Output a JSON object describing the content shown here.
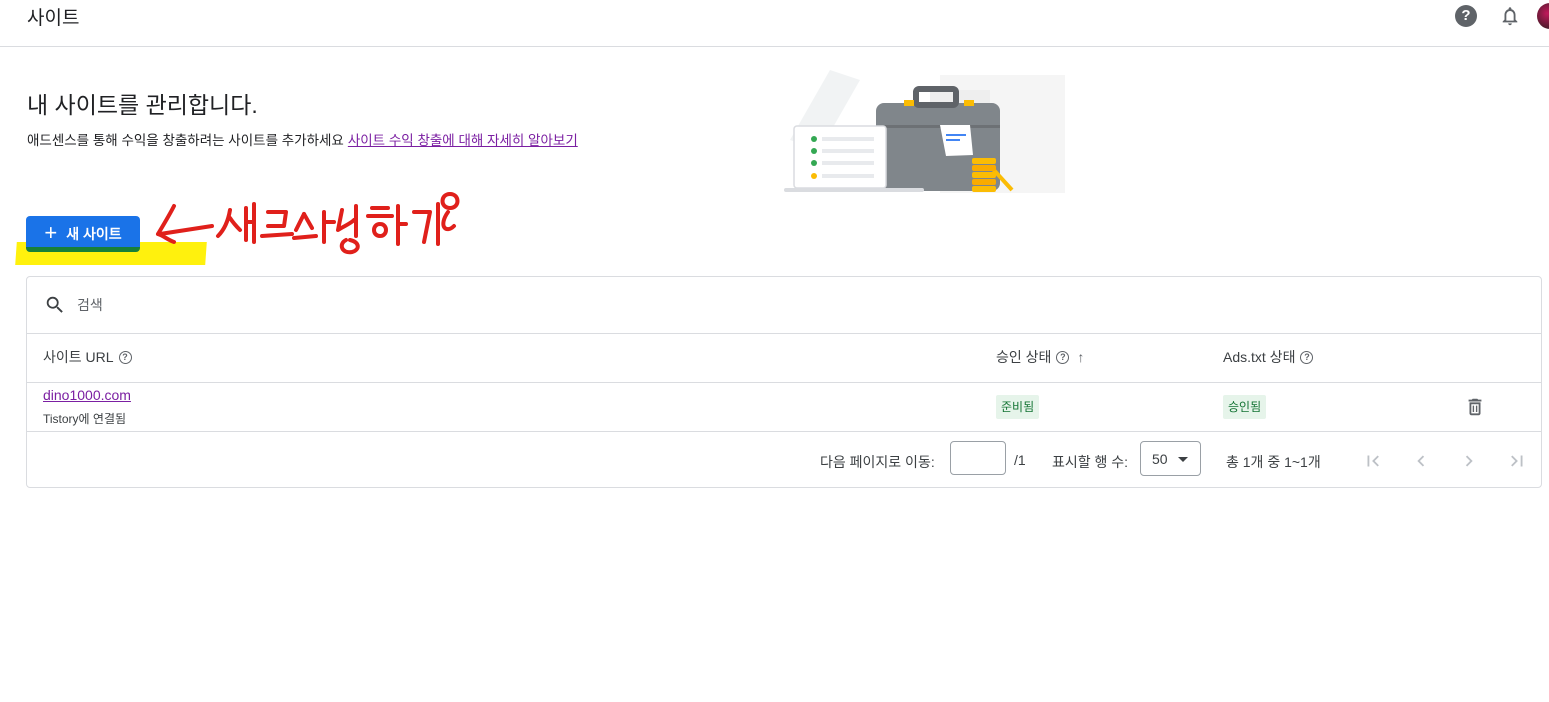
{
  "topbar": {
    "title": "사이트",
    "help_icon": "help-circle-icon",
    "help_glyph": "?",
    "notification_icon": "bell-icon"
  },
  "page": {
    "heading": "내 사이트를 관리합니다.",
    "description": "애드센스를 통해 수익을 창출하려는 사이트를 추가하세요",
    "learn_more_link": "사이트 수익 창출에 대해 자세히 알아보기"
  },
  "actions": {
    "new_site_label": "새 사이트",
    "plus_glyph": "+"
  },
  "annotation": {
    "handwritten_text": "새로신청하기",
    "color": "#e0201b",
    "highlight_color": "#fff000"
  },
  "search": {
    "placeholder": "검색"
  },
  "table": {
    "columns": {
      "site_url": "사이트 URL",
      "approval_status": "승인 상태",
      "ads_txt_status": "Ads.txt 상태"
    },
    "help_glyph": "?",
    "sort_glyph": "↑",
    "rows": [
      {
        "url": "dino1000.com",
        "subtitle": "Tistory에 연결됨",
        "approval_status": "준비됨",
        "ads_txt_status": "승인됨"
      }
    ]
  },
  "pagination": {
    "goto_label": "다음 페이지로 이동:",
    "page_input_value": "",
    "total_pages": "/1",
    "rows_per_page_label": "표시할 행 수:",
    "rows_per_page_value": "50",
    "range_text": "총 1개 중 1~1개"
  },
  "colors": {
    "primary": "#1a73e8",
    "link": "#7b1fa2",
    "status_green_bg": "#e6f4ea",
    "status_green_text": "#137333"
  }
}
